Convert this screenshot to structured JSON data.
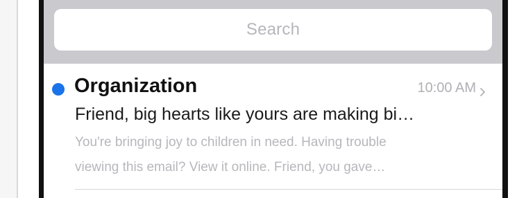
{
  "search": {
    "placeholder": "Search"
  },
  "mail": {
    "sender": "Organization",
    "time": "10:00 AM",
    "subject": "Friend, big hearts like yours are making bi…",
    "preview": [
      "You're bringing joy to children in need. Having trouble",
      "viewing this email? View it online. Friend, you gave…"
    ],
    "unread": true
  },
  "icons": {
    "unread": "unread-dot",
    "disclosure": "chevron-right-icon"
  },
  "colors": {
    "accent": "#1a73e8",
    "search_bar_bg": "#c9c9ce"
  }
}
